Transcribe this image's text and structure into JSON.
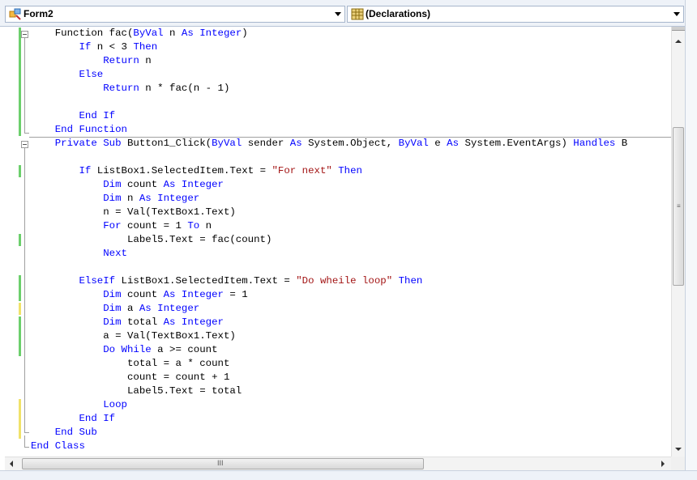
{
  "header": {
    "class_combo": {
      "label": "Form2",
      "icon": "form-class-icon"
    },
    "member_combo": {
      "label": "(Declarations)",
      "icon": "declarations-icon"
    }
  },
  "editor": {
    "lines": [
      [
        [
          "    Function fac(",
          ""
        ],
        [
          "ByVal",
          "kw"
        ],
        [
          " n ",
          ""
        ],
        [
          "As",
          "kw"
        ],
        [
          " ",
          ""
        ],
        [
          "Integer",
          "kw"
        ],
        [
          ")",
          ""
        ]
      ],
      [
        [
          "        ",
          ""
        ],
        [
          "If",
          "kw"
        ],
        [
          " n < 3 ",
          ""
        ],
        [
          "Then",
          "kw"
        ]
      ],
      [
        [
          "            ",
          ""
        ],
        [
          "Return",
          "kw"
        ],
        [
          " n",
          ""
        ]
      ],
      [
        [
          "        ",
          ""
        ],
        [
          "Else",
          "kw"
        ]
      ],
      [
        [
          "            ",
          ""
        ],
        [
          "Return",
          "kw"
        ],
        [
          " n * fac(n - 1)",
          ""
        ]
      ],
      [
        [
          "",
          ""
        ]
      ],
      [
        [
          "        ",
          ""
        ],
        [
          "End If",
          "kw"
        ]
      ],
      [
        [
          "    ",
          ""
        ],
        [
          "End Function",
          "kw"
        ]
      ],
      [
        [
          "    ",
          ""
        ],
        [
          "Private Sub",
          "kw"
        ],
        [
          " Button1_Click(",
          ""
        ],
        [
          "ByVal",
          "kw"
        ],
        [
          " sender ",
          ""
        ],
        [
          "As",
          "kw"
        ],
        [
          " System.Object, ",
          ""
        ],
        [
          "ByVal",
          "kw"
        ],
        [
          " e ",
          ""
        ],
        [
          "As",
          "kw"
        ],
        [
          " System.EventArgs) ",
          ""
        ],
        [
          "Handles",
          "kw"
        ],
        [
          " B",
          ""
        ]
      ],
      [
        [
          "",
          ""
        ]
      ],
      [
        [
          "        ",
          ""
        ],
        [
          "If",
          "kw"
        ],
        [
          " ListBox1.SelectedItem.Text = ",
          ""
        ],
        [
          "\"For next\"",
          "str"
        ],
        [
          " ",
          ""
        ],
        [
          "Then",
          "kw"
        ]
      ],
      [
        [
          "            ",
          ""
        ],
        [
          "Dim",
          "kw"
        ],
        [
          " count ",
          ""
        ],
        [
          "As",
          "kw"
        ],
        [
          " ",
          ""
        ],
        [
          "Integer",
          "kw"
        ]
      ],
      [
        [
          "            ",
          ""
        ],
        [
          "Dim",
          "kw"
        ],
        [
          " n ",
          ""
        ],
        [
          "As",
          "kw"
        ],
        [
          " ",
          ""
        ],
        [
          "Integer",
          "kw"
        ]
      ],
      [
        [
          "            n = Val(TextBox1.Text)",
          ""
        ]
      ],
      [
        [
          "            ",
          ""
        ],
        [
          "For",
          "kw"
        ],
        [
          " count = 1 ",
          ""
        ],
        [
          "To",
          "kw"
        ],
        [
          " n",
          ""
        ]
      ],
      [
        [
          "                Label5.Text = fac(count)",
          ""
        ]
      ],
      [
        [
          "            ",
          ""
        ],
        [
          "Next",
          "kw"
        ]
      ],
      [
        [
          "",
          ""
        ]
      ],
      [
        [
          "        ",
          ""
        ],
        [
          "ElseIf",
          "kw"
        ],
        [
          " ListBox1.SelectedItem.Text = ",
          ""
        ],
        [
          "\"Do wheile loop\"",
          "str"
        ],
        [
          " ",
          ""
        ],
        [
          "Then",
          "kw"
        ]
      ],
      [
        [
          "            ",
          ""
        ],
        [
          "Dim",
          "kw"
        ],
        [
          " count ",
          ""
        ],
        [
          "As",
          "kw"
        ],
        [
          " ",
          ""
        ],
        [
          "Integer",
          "kw"
        ],
        [
          " = 1",
          ""
        ]
      ],
      [
        [
          "            ",
          ""
        ],
        [
          "Dim",
          "kw"
        ],
        [
          " a ",
          ""
        ],
        [
          "As",
          "kw"
        ],
        [
          " ",
          ""
        ],
        [
          "Integer",
          "kw"
        ]
      ],
      [
        [
          "            ",
          ""
        ],
        [
          "Dim",
          "kw"
        ],
        [
          " total ",
          ""
        ],
        [
          "As",
          "kw"
        ],
        [
          " ",
          ""
        ],
        [
          "Integer",
          "kw"
        ]
      ],
      [
        [
          "            a = Val(TextBox1.Text)",
          ""
        ]
      ],
      [
        [
          "            ",
          ""
        ],
        [
          "Do While",
          "kw"
        ],
        [
          " a >= count",
          ""
        ]
      ],
      [
        [
          "                total = a * count",
          ""
        ]
      ],
      [
        [
          "                count = count + 1",
          ""
        ]
      ],
      [
        [
          "                Label5.Text = total",
          ""
        ]
      ],
      [
        [
          "            ",
          ""
        ],
        [
          "Loop",
          "kw"
        ]
      ],
      [
        [
          "        ",
          ""
        ],
        [
          "End If",
          "kw"
        ]
      ],
      [
        [
          "    ",
          ""
        ],
        [
          "End Sub",
          "kw"
        ]
      ],
      [
        [
          "",
          ""
        ],
        [
          "End Class",
          "kw"
        ]
      ]
    ],
    "change_markers": [
      {
        "from": 0,
        "to": 7,
        "status": "saved"
      },
      {
        "from": 10,
        "to": 10,
        "status": "saved"
      },
      {
        "from": 15,
        "to": 15,
        "status": "saved"
      },
      {
        "from": 18,
        "to": 19,
        "status": "saved"
      },
      {
        "from": 20,
        "to": 20,
        "status": "unsaved"
      },
      {
        "from": 21,
        "to": 23,
        "status": "saved"
      },
      {
        "from": 27,
        "to": 29,
        "status": "unsaved"
      }
    ],
    "colors": {
      "keyword": "#0000ff",
      "string": "#a31515",
      "saved_change": "#6ccf6c",
      "unsaved_change": "#f0e26a"
    }
  },
  "scrollbars": {
    "horizontal_grip": "III",
    "vertical_grip": "≡"
  }
}
